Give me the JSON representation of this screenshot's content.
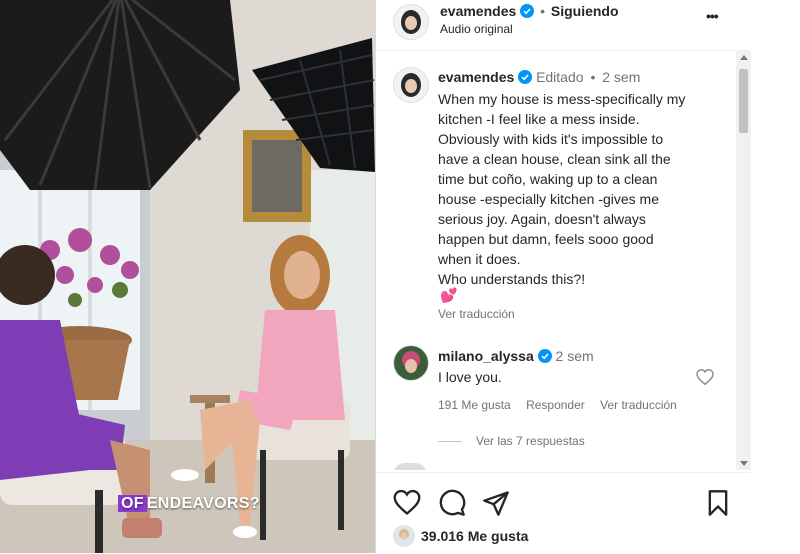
{
  "header": {
    "username": "evamendes",
    "separator": "•",
    "follow_status": "Siguiendo",
    "audio": "Audio original",
    "more_label": "•••"
  },
  "video": {
    "caption_overlay_highlight": "OF",
    "caption_overlay_rest": "ENDEAVORS?"
  },
  "caption": {
    "username": "evamendes",
    "edited": "Editado",
    "separator": "•",
    "time": "2 sem",
    "text": "When my house is mess-specifically my\nkitchen -I feel like a mess inside.\nObviously with kids it's impossible to\nhave a clean house, clean sink all the\ntime but coño, waking up to a clean\nhouse -especially kitchen -gives me\nserious joy. Again, doesn't always\nhappen but damn, feels sooo good\nwhen it does.\nWho understands this?!",
    "emoji": "💕",
    "translate": "Ver traducción"
  },
  "comment": {
    "username": "milano_alyssa",
    "time": "2 sem",
    "text": "I love you.",
    "likes": "191 Me gusta",
    "reply": "Responder",
    "translate": "Ver traducción",
    "view_replies": "Ver las 7 respuestas"
  },
  "footer": {
    "likes": "39.016 Me gusta"
  },
  "colors": {
    "verified": "#0095f6",
    "text": "#262626",
    "muted": "#737373",
    "overlay_purple": "#8a3ad0"
  }
}
